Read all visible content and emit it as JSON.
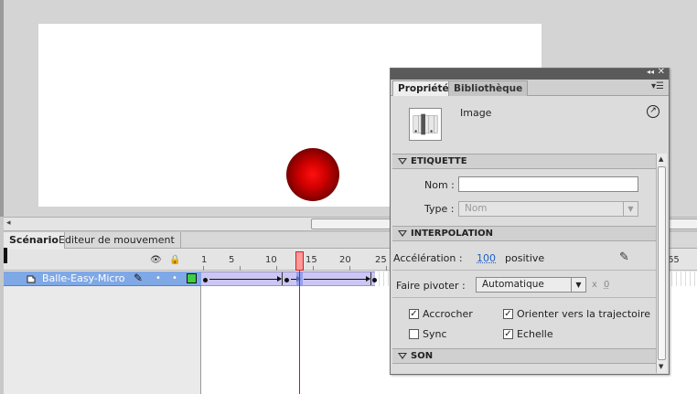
{
  "timeline": {
    "tabs": [
      "Scénario",
      "Editeur de mouvement"
    ],
    "ruler": [
      "1",
      "5",
      "10",
      "15",
      "20",
      "25",
      "65"
    ],
    "layer": {
      "name": "Balle-Easy-Micro",
      "color": "#3fd03f"
    },
    "current_frame": 14
  },
  "props": {
    "tabs": [
      "Propriétés",
      "Bibliothèque"
    ],
    "frame_type": "Image",
    "etiquette": {
      "title": "ETIQUETTE",
      "name_label": "Nom :",
      "name_value": "",
      "type_label": "Type :",
      "type_value": "Nom"
    },
    "interpolation": {
      "title": "INTERPOLATION",
      "accel_label": "Accélération :",
      "accel_value": "100",
      "accel_desc": "positive",
      "rotate_label": "Faire pivoter :",
      "rotate_value": "Automatique",
      "times_sign": "x",
      "rotate_count": "0",
      "checks": [
        {
          "label": "Accrocher",
          "checked": true
        },
        {
          "label": "Orienter vers la trajectoire",
          "checked": true
        },
        {
          "label": "Sync",
          "checked": false
        },
        {
          "label": "Echelle",
          "checked": true
        }
      ]
    },
    "son": {
      "title": "SON"
    }
  },
  "colors": {
    "accent": "#7fa8e6",
    "playhead": "#e01010",
    "tween": "#cbc6f2"
  }
}
